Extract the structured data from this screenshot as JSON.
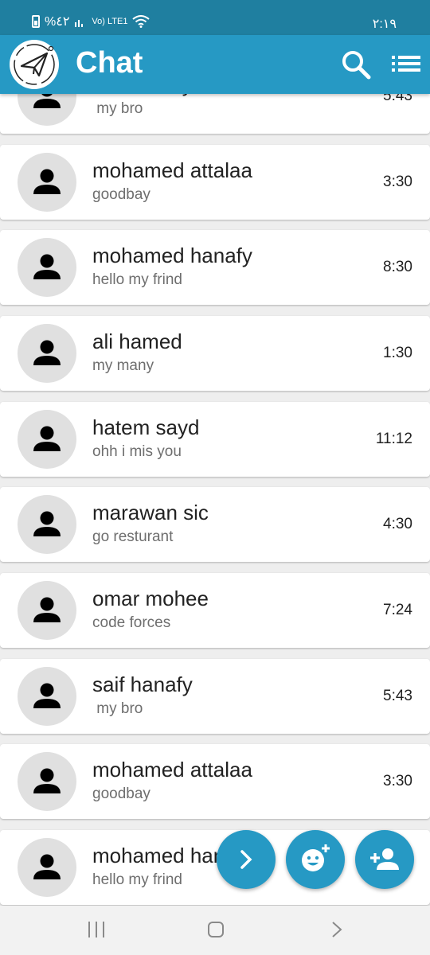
{
  "status_bar": {
    "battery_text": "%٤٢",
    "network_text": "Vo) LTE1",
    "time": "٢:١٩"
  },
  "app_bar": {
    "title": "Chat",
    "logo_icon": "paper-plane-icon",
    "search_icon": "search-icon",
    "menu_icon": "list-menu-icon",
    "color": "#2699c4"
  },
  "chats": [
    {
      "name": "saif hanafy",
      "message": " my bro",
      "time": "5:43"
    },
    {
      "name": "mohamed attalaa",
      "message": "goodbay",
      "time": "3:30"
    },
    {
      "name": "mohamed hanafy",
      "message": "hello my frind",
      "time": "8:30"
    },
    {
      "name": "ali hamed",
      "message": "my many",
      "time": "1:30"
    },
    {
      "name": "hatem sayd",
      "message": "ohh i mis you",
      "time": "11:12"
    },
    {
      "name": "marawan sic",
      "message": "go resturant",
      "time": "4:30"
    },
    {
      "name": "omar mohee",
      "message": "code forces",
      "time": "7:24"
    },
    {
      "name": "saif hanafy",
      "message": " my bro",
      "time": "5:43"
    },
    {
      "name": "mohamed attalaa",
      "message": "goodbay",
      "time": "3:30"
    },
    {
      "name": "mohamed hanafy",
      "message": "hello my frind",
      "time": "8:30"
    }
  ],
  "fabs": [
    {
      "icon": "chevron-right-icon"
    },
    {
      "icon": "add-emoji-icon"
    },
    {
      "icon": "add-person-icon"
    }
  ],
  "nav_bar": {
    "recents_icon": "recents-icon",
    "home_icon": "home-icon",
    "back_icon": "back-chevron-icon"
  }
}
